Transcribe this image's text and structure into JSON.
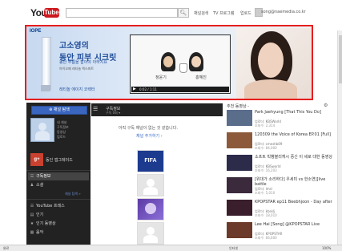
{
  "header": {
    "logo_you": "You",
    "logo_tube": "Tube",
    "search_placeholder": "",
    "nav": [
      "채널검색",
      "TV 프로그램",
      "업로드"
    ],
    "user": "song@naemedia.co.kr"
  },
  "banner": {
    "brand": "IOPE",
    "title_line1": "고소영의",
    "title_line2": "동안 피부 시크릿",
    "subtitle": "동안 주름을 잡아야 아하지요",
    "smalltext": "아이오페 레티놀 엑스퍼트",
    "link": "레티놀 에이지 코렉터",
    "video_names": [
      "정윤기",
      "홍혜진"
    ],
    "video_time": "0:02 / 1:11"
  },
  "left_nav": {
    "all_channels": "채널 탐색",
    "profile_lines": [
      "내 채널",
      "구독정보",
      "동영상",
      "업로드"
    ],
    "connect": "동인 앱그레이드",
    "items": [
      {
        "icon": "list-icon",
        "label": "구독정보",
        "selected": true
      },
      {
        "icon": "person-icon",
        "label": "소셜",
        "selected": false
      },
      {
        "icon": "list-icon",
        "label": "YouTube 프레스",
        "selected": false
      },
      {
        "icon": "chart-icon",
        "label": "인기",
        "selected": false
      },
      {
        "icon": "star-icon",
        "label": "인기 동영상",
        "selected": false
      },
      {
        "icon": "film-icon",
        "label": "음악",
        "selected": false
      }
    ],
    "more": "채널 탐색 »"
  },
  "center": {
    "header_title": "구독정보",
    "header_sub": "구독 0회 ▾",
    "empty_message": "아직 구독 채널이 없는 것 같습니다.",
    "add_link": "채널 추가하기 ›",
    "fifa": "FIFA"
  },
  "right": {
    "header": "추천 동영상 -",
    "items": [
      {
        "title": "Park Jaehyung [That This You Do]",
        "channel": "업로더: KBSWorld",
        "views": "조회수: 2,314",
        "color": "#5a6e8c"
      },
      {
        "title": "120309 the Voice of Korea EP.01 [Full]",
        "channel": "업로더: cmeshb09",
        "views": "조회수: 84,000",
        "color": "#8c5a3a"
      },
      {
        "title": "소프트 빅뱅블리캐시 중신 이 세로 대한 동영상",
        "channel": "업로더: KBSworld",
        "views": "조회수: 16,203",
        "color": "#2c2c4a"
      },
      {
        "title": "[위대가 소리하다] 우세미 vs 한소연][live battle",
        "channel": "업로더: lmsl",
        "views": "조회수: 5,010",
        "color": "#3a2a3c"
      },
      {
        "title": "KPOPSTAR ep11 Beebhjoon - Day after",
        "channel": "업로더: kbsklj",
        "views": "조회수: 18,010",
        "color": "#3a1e2c"
      },
      {
        "title": "Lee Hai [Song] @KPOPSTAR Live",
        "channel": "업로더: KPOPSTAR",
        "views": "조회수: 66,600",
        "color": "#6c3a2a"
      }
    ]
  },
  "statusbar": {
    "left": "완료",
    "mid": "인터넷",
    "zoom": "100%"
  }
}
